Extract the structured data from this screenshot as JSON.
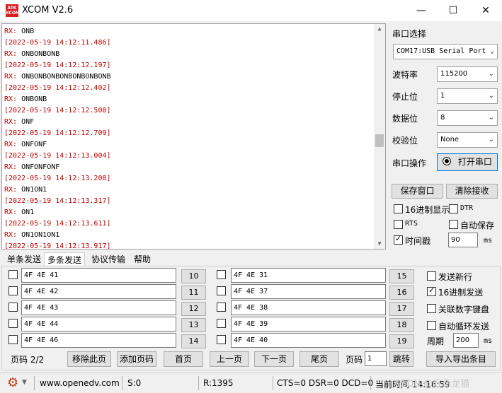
{
  "window": {
    "logo": "ATK\nXCOM",
    "title": "XCOM V2.6",
    "minimize": "—",
    "maximize": "☐",
    "close": "✕"
  },
  "receive": {
    "lines": [
      {
        "tag": "RX:",
        "text": " ONB"
      },
      {
        "ts": "[2022-05-19 14:12:11.486]"
      },
      {
        "tag": "RX:",
        "text": " ONBONBONB"
      },
      {
        "ts": "[2022-05-19 14:12:12.197]"
      },
      {
        "tag": "RX:",
        "text": " ONBONBONBONBONBONBONB"
      },
      {
        "ts": "[2022-05-19 14:12:12.402]"
      },
      {
        "tag": "RX:",
        "text": " ONBONB"
      },
      {
        "ts": "[2022-05-19 14:12:12.508]"
      },
      {
        "tag": "RX:",
        "text": " ONF"
      },
      {
        "ts": "[2022-05-19 14:12:12.709]"
      },
      {
        "tag": "RX:",
        "text": " ONFONF"
      },
      {
        "ts": "[2022-05-19 14:12:13.004]"
      },
      {
        "tag": "RX:",
        "text": " ONFONFONF"
      },
      {
        "ts": "[2022-05-19 14:12:13.208]"
      },
      {
        "tag": "RX:",
        "text": " ON1ON1"
      },
      {
        "ts": "[2022-05-19 14:12:13.317]"
      },
      {
        "tag": "RX:",
        "text": " ON1"
      },
      {
        "ts": "[2022-05-19 14:12:13.611]"
      },
      {
        "tag": "RX:",
        "text": " ON1ON1ON1"
      },
      {
        "ts": "[2022-05-19 14:12:13.917]"
      }
    ]
  },
  "serial": {
    "section_label": "串口选择",
    "port_value": "COM17:USB Serial Port",
    "baud_label": "波特率",
    "baud_value": "115200",
    "stop_label": "停止位",
    "stop_value": "1",
    "data_label": "数据位",
    "data_value": "8",
    "parity_label": "校验位",
    "parity_value": "None",
    "op_label": "串口操作",
    "open_button": "打开串口"
  },
  "actions": {
    "save_window": "保存窗口",
    "clear_recv": "清除接收",
    "hex_display": "16进制显示",
    "dtr": "DTR",
    "rts": "RTS",
    "auto_save": "自动保存",
    "timestamp": "时间戳",
    "timestamp_value": "90",
    "ms": "ms"
  },
  "tabs": [
    "单条发送",
    "多条发送",
    "协议传输",
    "帮助"
  ],
  "multi_send": {
    "left": [
      {
        "value": "4F 4E 41",
        "num": "10",
        "checked": false
      },
      {
        "value": "4F 4E 42",
        "num": "11",
        "checked": false
      },
      {
        "value": "4F 4E 43",
        "num": "12",
        "checked": false
      },
      {
        "value": "4F 4E 44",
        "num": "13",
        "checked": false
      },
      {
        "value": "4F 4E 46",
        "num": "14",
        "checked": false
      }
    ],
    "right": [
      {
        "value": "4F 4E 31",
        "num": "15",
        "checked": false
      },
      {
        "value": "4F 4E 37",
        "num": "16",
        "checked": false
      },
      {
        "value": "4F 4E 38",
        "num": "17",
        "checked": false
      },
      {
        "value": "4F 4E 39",
        "num": "18",
        "checked": false
      },
      {
        "value": "4F 4E 40",
        "num": "19",
        "checked": false
      }
    ],
    "send_newline": "发送新行",
    "hex_send": "16进制发送",
    "link_keyboard": "关联数字键盘",
    "auto_loop": "自动循环发送",
    "period_label": "周期",
    "period_value": "200",
    "period_unit": "ms",
    "page_label": "页码 2/2",
    "remove_page": "移除此页",
    "add_page": "添加页码",
    "first_page": "首页",
    "prev_page": "上一页",
    "next_page": "下一页",
    "last_page": "尾页",
    "page_input_label": "页码",
    "page_input_value": "1",
    "jump": "跳转",
    "import_export": "导入导出条目"
  },
  "status": {
    "gear": "⚙",
    "url": "www.openedv.com",
    "s": "S:0",
    "r": "R:1395",
    "lines": "CTS=0 DSR=0 DCD=0",
    "time": "当前时间 14:16:59",
    "watermark": "CSDN @好奇龙猫"
  },
  "colors": {
    "rx": "#c00000",
    "accent": "#0078d7"
  }
}
